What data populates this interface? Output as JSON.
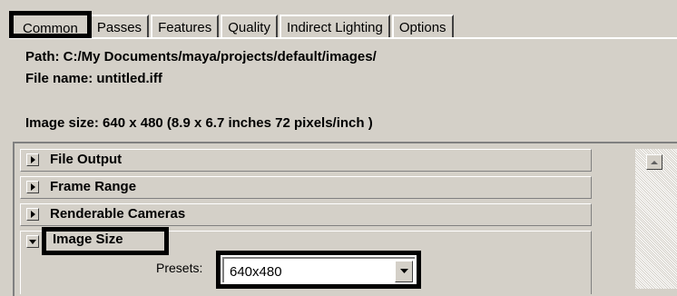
{
  "tabs": [
    {
      "label": "Common",
      "active": true
    },
    {
      "label": "Passes"
    },
    {
      "label": "Features"
    },
    {
      "label": "Quality"
    },
    {
      "label": "Indirect Lighting"
    },
    {
      "label": "Options"
    }
  ],
  "info": {
    "path": "Path: C:/My Documents/maya/projects/default/images/",
    "file_name": "File name:  untitled.iff",
    "image_size": "Image size: 640 x 480 (8.9 x 6.7 inches 72 pixels/inch )"
  },
  "sections": [
    {
      "label": "File Output",
      "expanded": false
    },
    {
      "label": "Frame Range",
      "expanded": false
    },
    {
      "label": "Renderable Cameras",
      "expanded": false
    },
    {
      "label": "Image Size",
      "expanded": true
    }
  ],
  "image_size_section": {
    "presets_label": "Presets:",
    "presets_value": "640x480"
  },
  "icons": {
    "collapsed": "triangle-right-icon",
    "expanded": "triangle-down-icon",
    "scroll_up": "scroll-up-arrow-icon",
    "dropdown": "triangle-down-icon"
  }
}
